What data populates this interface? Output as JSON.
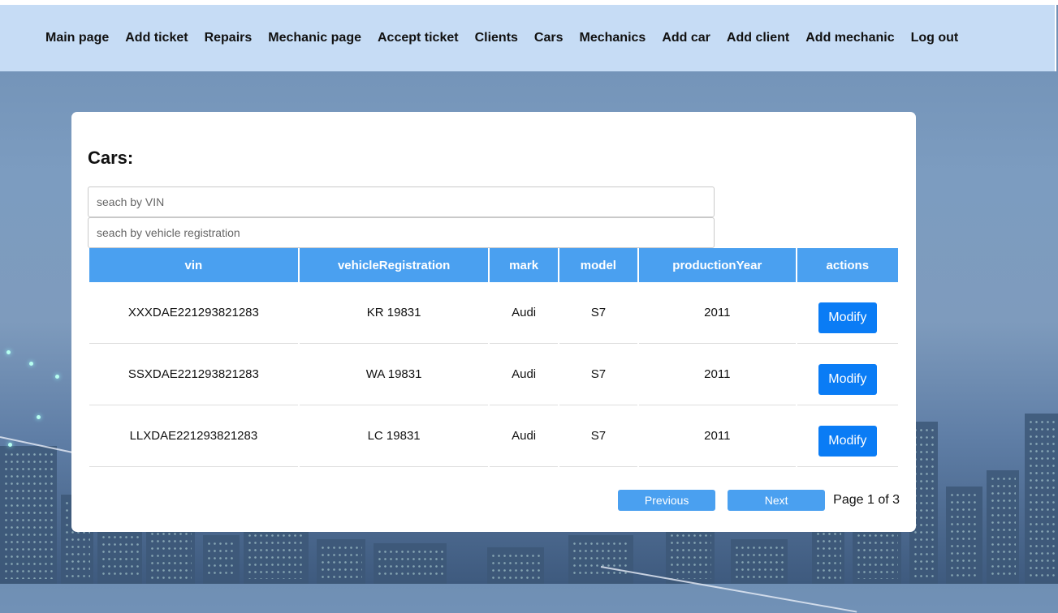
{
  "nav": [
    {
      "label": "Main page"
    },
    {
      "label": "Add ticket"
    },
    {
      "label": "Repairs"
    },
    {
      "label": "Mechanic page"
    },
    {
      "label": "Accept ticket"
    },
    {
      "label": "Clients"
    },
    {
      "label": "Cars"
    },
    {
      "label": "Mechanics"
    },
    {
      "label": "Add car"
    },
    {
      "label": "Add client"
    },
    {
      "label": "Add mechanic"
    },
    {
      "label": "Log out"
    }
  ],
  "page": {
    "title": "Cars:"
  },
  "search": {
    "vin_placeholder": "seach by VIN",
    "vin_value": "",
    "registration_placeholder": "seach by vehicle registration",
    "registration_value": ""
  },
  "table": {
    "columns": [
      "vin",
      "vehicleRegistration",
      "mark",
      "model",
      "productionYear",
      "actions"
    ],
    "rows": [
      {
        "vin": "XXXDAE221293821283",
        "vehicleRegistration": "KR 19831",
        "mark": "Audi",
        "model": "S7",
        "productionYear": "2011",
        "action": "Modify"
      },
      {
        "vin": "SSXDAE221293821283",
        "vehicleRegistration": "WA 19831",
        "mark": "Audi",
        "model": "S7",
        "productionYear": "2011",
        "action": "Modify"
      },
      {
        "vin": "LLXDAE221293821283",
        "vehicleRegistration": "LC 19831",
        "mark": "Audi",
        "model": "S7",
        "productionYear": "2011",
        "action": "Modify"
      }
    ]
  },
  "pagination": {
    "previous_label": "Previous",
    "next_label": "Next",
    "page_info": "Page 1 of 3"
  },
  "colors": {
    "navbar": "#c6dcf5",
    "header": "#4aa0f0",
    "button": "#0a7cf5"
  }
}
